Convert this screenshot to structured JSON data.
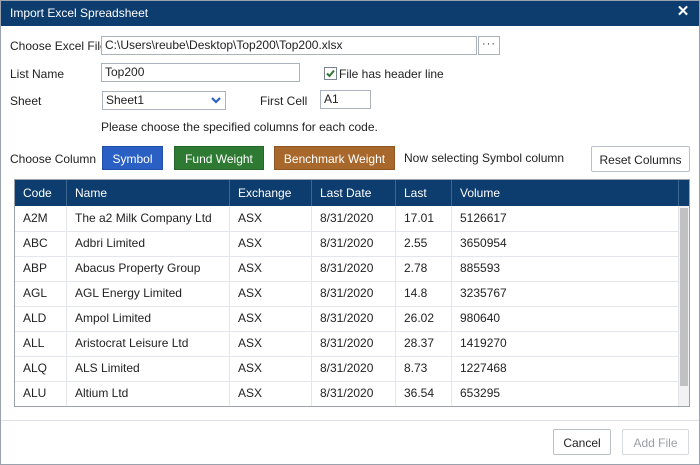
{
  "window": {
    "title": "Import Excel Spreadsheet",
    "close_glyph": "✕"
  },
  "form": {
    "file_label": "Choose Excel File",
    "file_value": "C:\\Users\\reube\\Desktop\\Top200\\Top200.xlsx",
    "browse_label": "···",
    "listname_label": "List Name",
    "listname_value": "Top200",
    "header_checkbox_label": "File has header line",
    "header_checked": true,
    "sheet_label": "Sheet",
    "sheet_value": "Sheet1",
    "firstcell_label": "First Cell",
    "firstcell_value": "A1",
    "instruction": "Please choose the specified columns for each code."
  },
  "columns_bar": {
    "label": "Choose Column",
    "symbol_button": "Symbol",
    "fund_weight_button": "Fund Weight",
    "benchmark_weight_button": "Benchmark Weight",
    "status": "Now selecting Symbol column",
    "reset_button": "Reset Columns"
  },
  "colors": {
    "title_bar": "#0d3c6e",
    "symbol": "#2a60c4",
    "fund_weight": "#2e7a33",
    "benchmark_weight": "#a8682b"
  },
  "table": {
    "headers": [
      "Code",
      "Name",
      "Exchange",
      "Last Date",
      "Last",
      "Volume"
    ],
    "rows": [
      [
        "A2M",
        "The a2 Milk Company Ltd",
        "ASX",
        "8/31/2020",
        "17.01",
        "5126617"
      ],
      [
        "ABC",
        "Adbri Limited",
        "ASX",
        "8/31/2020",
        "2.55",
        "3650954"
      ],
      [
        "ABP",
        "Abacus Property Group",
        "ASX",
        "8/31/2020",
        "2.78",
        "885593"
      ],
      [
        "AGL",
        "AGL Energy Limited",
        "ASX",
        "8/31/2020",
        "14.8",
        "3235767"
      ],
      [
        "ALD",
        "Ampol Limited",
        "ASX",
        "8/31/2020",
        "26.02",
        "980640"
      ],
      [
        "ALL",
        "Aristocrat Leisure Ltd",
        "ASX",
        "8/31/2020",
        "28.37",
        "1419270"
      ],
      [
        "ALQ",
        "ALS Limited",
        "ASX",
        "8/31/2020",
        "8.73",
        "1227468"
      ],
      [
        "ALU",
        "Altium Ltd",
        "ASX",
        "8/31/2020",
        "36.54",
        "653295"
      ]
    ]
  },
  "footer": {
    "cancel_button": "Cancel",
    "add_button": "Add File"
  }
}
